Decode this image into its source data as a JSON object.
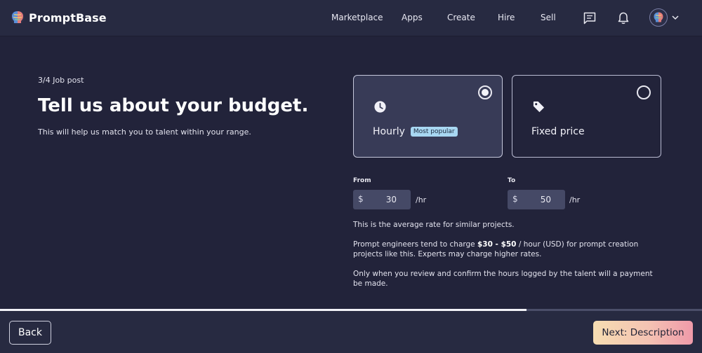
{
  "nav": {
    "brand": "PromptBase",
    "links": [
      "Marketplace",
      "Apps",
      "Create",
      "Hire",
      "Sell"
    ],
    "icons": [
      "message-icon",
      "bell-icon",
      "avatar-icon",
      "chevron-down-icon"
    ]
  },
  "step": "3/4 Job post",
  "title": "Tell us about your budget.",
  "subtitle": "This will help us match you to talent within your range.",
  "options": [
    {
      "label": "Hourly",
      "badge": "Most popular",
      "icon": "clock-icon",
      "selected": true
    },
    {
      "label": "Fixed price",
      "icon": "tag-icon",
      "selected": false
    }
  ],
  "rate": {
    "from_label": "From",
    "to_label": "To",
    "currency": "$",
    "from_value": "30",
    "to_value": "50",
    "unit": "/hr"
  },
  "info": {
    "average": "This is the average rate for similar projects.",
    "charge_prefix": "Prompt engineers tend to charge ",
    "charge_range": "$30 - $50",
    "charge_suffix": " / hour (USD) for prompt creation projects like this. Experts may charge higher rates.",
    "payment": "Only when you review and confirm the hours logged by the talent will a payment be made."
  },
  "progress": 0.75,
  "footer": {
    "back": "Back",
    "next": "Next: Description"
  },
  "colors": {
    "background": "#22233a",
    "badge": "#a8d7f2",
    "next_gradient": [
      "#f6ddb2",
      "#ef9aa9"
    ]
  }
}
